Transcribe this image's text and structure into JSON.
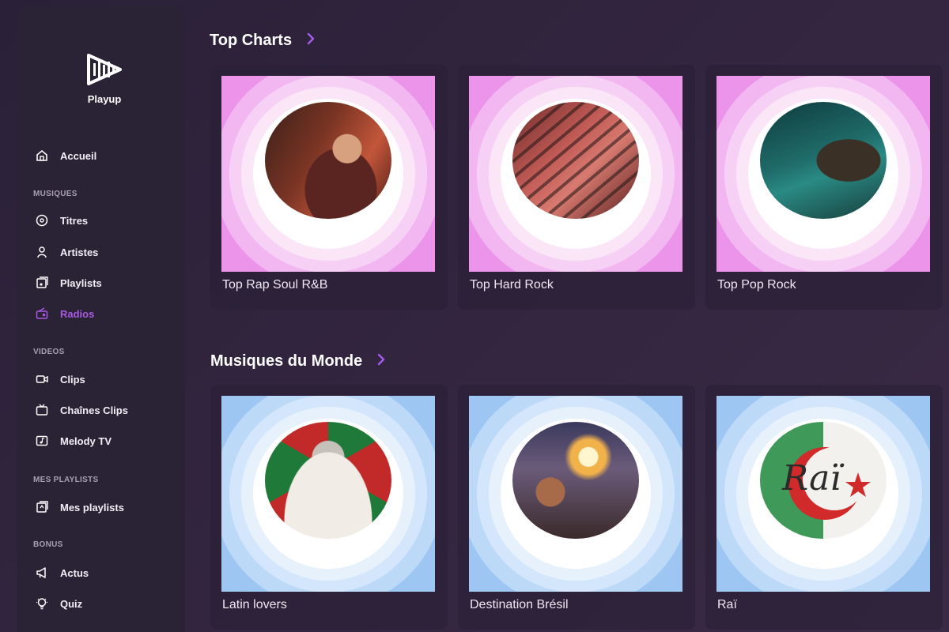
{
  "brand": {
    "name": "Playup"
  },
  "sidebar": {
    "items": [
      {
        "label": "Accueil",
        "icon": "home-icon"
      },
      {
        "label": "Titres",
        "icon": "disc-icon"
      },
      {
        "label": "Artistes",
        "icon": "person-icon"
      },
      {
        "label": "Playlists",
        "icon": "playlist-icon"
      },
      {
        "label": "Radios",
        "icon": "radio-icon",
        "active": true
      },
      {
        "label": "Clips",
        "icon": "camera-icon"
      },
      {
        "label": "Chaînes Clips",
        "icon": "tv-icon"
      },
      {
        "label": "Melody TV",
        "icon": "melody-tv-icon"
      },
      {
        "label": "Mes playlists",
        "icon": "my-playlist-icon"
      },
      {
        "label": "Actus",
        "icon": "megaphone-icon"
      },
      {
        "label": "Quiz",
        "icon": "bulb-icon"
      }
    ],
    "headings": [
      "MUSIQUES",
      "VIDEOS",
      "MES PLAYLISTS",
      "BONUS"
    ]
  },
  "sections": [
    {
      "title": "Top Charts",
      "cards": [
        {
          "label": "Top Rap Soul R&B",
          "theme": "pink"
        },
        {
          "label": "Top Hard Rock",
          "theme": "pink"
        },
        {
          "label": "Top Pop Rock",
          "theme": "pink"
        }
      ]
    },
    {
      "title": "Musiques du Monde",
      "cards": [
        {
          "label": "Latin lovers",
          "theme": "blue"
        },
        {
          "label": "Destination Brésil",
          "theme": "blue"
        },
        {
          "label": "Raï",
          "theme": "blue",
          "cover_text": "Raï"
        }
      ]
    }
  ],
  "colors": {
    "accent": "#a35cf0",
    "active_nav": "#a65be0",
    "sidebar_bg": "#2a2235"
  }
}
